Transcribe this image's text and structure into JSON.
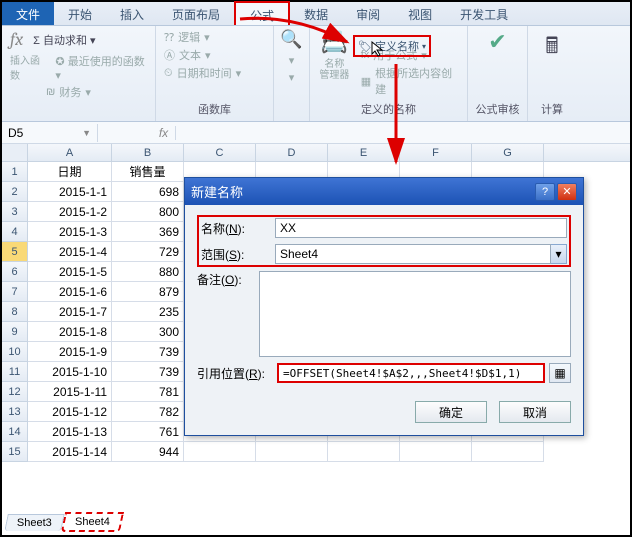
{
  "tabs": {
    "file": "文件",
    "start": "开始",
    "insert": "插入",
    "layout": "页面布局",
    "formula": "公式",
    "data": "数据",
    "review": "审阅",
    "view": "视图",
    "dev": "开发工具"
  },
  "ribbon": {
    "autosum": "自动求和",
    "recent": "最近使用的函数",
    "finance": "财务",
    "logic": "逻辑",
    "text": "文本",
    "datetime": "日期和时间",
    "name_mgr": "名称\n管理器",
    "define": "定义名称",
    "use_in": "用于公式",
    "from_sel": "根据所选内容创建",
    "lib": "函数库",
    "defined": "定义的名称",
    "audit": "公式审核",
    "calc": "计算",
    "insert_fn": "插入函数"
  },
  "namebox": "D5",
  "cols": [
    "A",
    "B",
    "C",
    "D",
    "E",
    "F",
    "G"
  ],
  "headers": {
    "date": "日期",
    "sales": "销售量"
  },
  "rows": [
    {
      "d": "2015-1-1",
      "v": "698"
    },
    {
      "d": "2015-1-2",
      "v": "800"
    },
    {
      "d": "2015-1-3",
      "v": "369"
    },
    {
      "d": "2015-1-4",
      "v": "729"
    },
    {
      "d": "2015-1-5",
      "v": "880"
    },
    {
      "d": "2015-1-6",
      "v": "879"
    },
    {
      "d": "2015-1-7",
      "v": "235"
    },
    {
      "d": "2015-1-8",
      "v": "300"
    },
    {
      "d": "2015-1-9",
      "v": "739"
    },
    {
      "d": "2015-1-10",
      "v": "739"
    },
    {
      "d": "2015-1-11",
      "v": "781"
    },
    {
      "d": "2015-1-12",
      "v": "782"
    },
    {
      "d": "2015-1-13",
      "v": "761"
    },
    {
      "d": "2015-1-14",
      "v": "944"
    }
  ],
  "sheets": {
    "s3": "Sheet3",
    "s4": "Sheet4"
  },
  "dialog": {
    "title": "新建名称",
    "name_l": "名称(N):",
    "name_v": "XX",
    "scope_l": "范围(S):",
    "scope_v": "Sheet4",
    "memo_l": "备注(O):",
    "ref_l": "引用位置(R):",
    "ref_v": "=OFFSET(Sheet4!$A$2,,,Sheet4!$D$1,1)",
    "ok": "确定",
    "cancel": "取消"
  },
  "underline": {
    "N": "N",
    "S": "S",
    "O": "O",
    "R": "R"
  }
}
